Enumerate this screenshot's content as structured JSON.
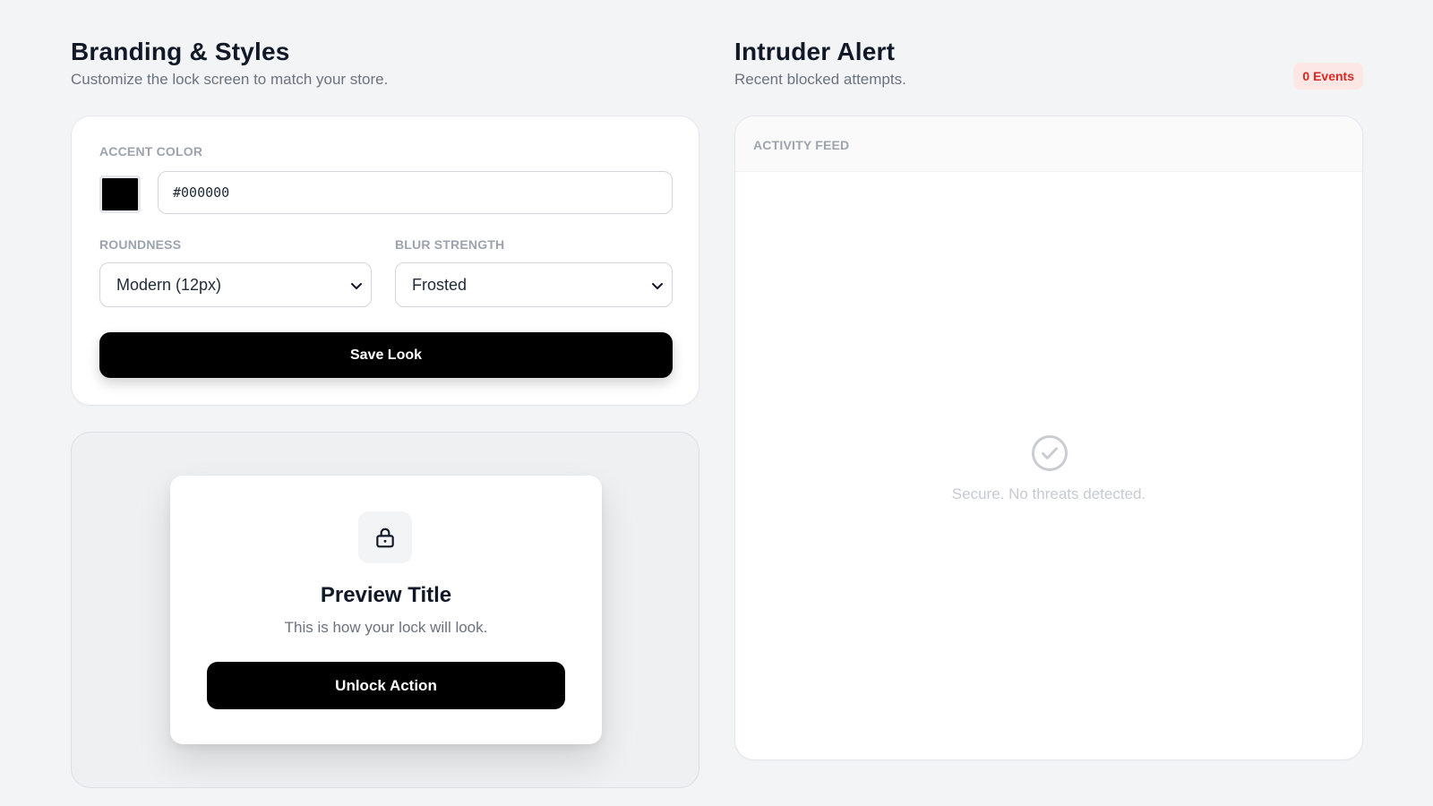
{
  "branding": {
    "title": "Branding & Styles",
    "subtitle": "Customize the lock screen to match your store.",
    "accent_label": "ACCENT COLOR",
    "accent_value": "#000000",
    "roundness_label": "ROUNDNESS",
    "roundness_value": "Modern (12px)",
    "blur_label": "BLUR STRENGTH",
    "blur_value": "Frosted",
    "save_label": "Save Look"
  },
  "preview": {
    "icon": "lock-icon",
    "title": "Preview Title",
    "subtitle": "This is how your lock will look.",
    "button_label": "Unlock Action"
  },
  "intruder": {
    "title": "Intruder Alert",
    "subtitle": "Recent blocked attempts.",
    "badge": "0 Events",
    "feed_header": "ACTIVITY FEED",
    "empty_icon": "check-circle-icon",
    "empty_text": "Secure. No threats detected."
  },
  "colors": {
    "accent": "#000000",
    "badge_bg": "#fde7e4",
    "badge_text": "#dc2626",
    "background": "#f3f4f6"
  }
}
